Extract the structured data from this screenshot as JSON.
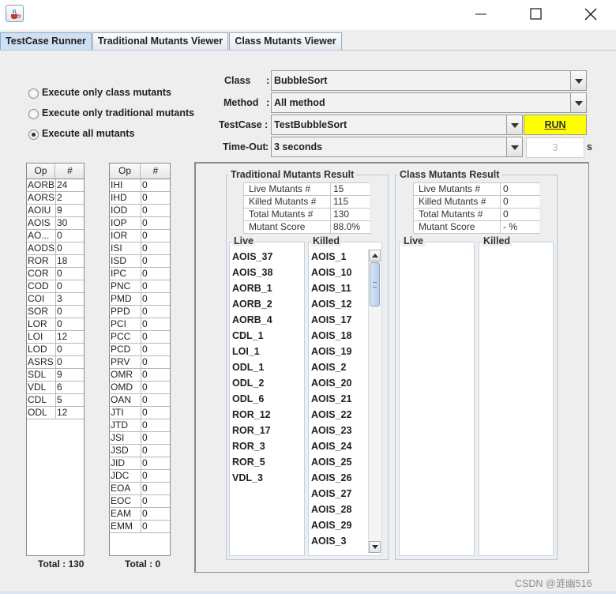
{
  "window": {
    "icons": {
      "app": "java-coffee-cup-icon",
      "minimize": "minimize-icon",
      "maximize": "maximize-icon",
      "close": "close-icon"
    }
  },
  "tabs": [
    "TestCase Runner",
    "Traditional Mutants Viewer",
    "Class Mutants Viewer"
  ],
  "radios": [
    {
      "label": "Execute only class mutants",
      "selected": false
    },
    {
      "label": "Execute only traditional mutants",
      "selected": false
    },
    {
      "label": "Execute all mutants",
      "selected": true
    }
  ],
  "form": {
    "class_label": "Class",
    "class_value": "BubbleSort",
    "method_label": "Method",
    "method_value": "All method",
    "testcase_label": "TestCase",
    "testcase_value": "TestBubbleSort",
    "timeout_label": "Time-Out",
    "timeout_value": "3 seconds",
    "colon": ":",
    "run_label": "RUN",
    "timeout_field_value": "3",
    "timeout_unit": "s"
  },
  "traditional_ops": {
    "headers": [
      "Op",
      "#"
    ],
    "rows": [
      [
        "AORB",
        "24"
      ],
      [
        "AORS",
        "2"
      ],
      [
        "AOIU",
        "9"
      ],
      [
        "AOIS",
        "30"
      ],
      [
        "AO...",
        "0"
      ],
      [
        "AODS",
        "0"
      ],
      [
        "ROR",
        "18"
      ],
      [
        "COR",
        "0"
      ],
      [
        "COD",
        "0"
      ],
      [
        "COI",
        "3"
      ],
      [
        "SOR",
        "0"
      ],
      [
        "LOR",
        "0"
      ],
      [
        "LOI",
        "12"
      ],
      [
        "LOD",
        "0"
      ],
      [
        "ASRS",
        "0"
      ],
      [
        "SDL",
        "9"
      ],
      [
        "VDL",
        "6"
      ],
      [
        "CDL",
        "5"
      ],
      [
        "ODL",
        "12"
      ]
    ],
    "total_label": "Total : 130"
  },
  "class_ops": {
    "headers": [
      "Op",
      "#"
    ],
    "rows": [
      [
        "IHI",
        "0"
      ],
      [
        "IHD",
        "0"
      ],
      [
        "IOD",
        "0"
      ],
      [
        "IOP",
        "0"
      ],
      [
        "IOR",
        "0"
      ],
      [
        "ISI",
        "0"
      ],
      [
        "ISD",
        "0"
      ],
      [
        "IPC",
        "0"
      ],
      [
        "PNC",
        "0"
      ],
      [
        "PMD",
        "0"
      ],
      [
        "PPD",
        "0"
      ],
      [
        "PCI",
        "0"
      ],
      [
        "PCC",
        "0"
      ],
      [
        "PCD",
        "0"
      ],
      [
        "PRV",
        "0"
      ],
      [
        "OMR",
        "0"
      ],
      [
        "OMD",
        "0"
      ],
      [
        "OAN",
        "0"
      ],
      [
        "JTI",
        "0"
      ],
      [
        "JTD",
        "0"
      ],
      [
        "JSI",
        "0"
      ],
      [
        "JSD",
        "0"
      ],
      [
        "JID",
        "0"
      ],
      [
        "JDC",
        "0"
      ],
      [
        "EOA",
        "0"
      ],
      [
        "EOC",
        "0"
      ],
      [
        "EAM",
        "0"
      ],
      [
        "EMM",
        "0"
      ]
    ],
    "total_label": "Total : 0"
  },
  "traditional_result": {
    "title": "Traditional Mutants Result",
    "stats": [
      {
        "label": "Live Mutants #",
        "value": "15"
      },
      {
        "label": "Killed Mutants #",
        "value": "115"
      },
      {
        "label": "Total Mutants #",
        "value": "130"
      },
      {
        "label": "Mutant Score",
        "value": "88.0%"
      }
    ],
    "live_title": "Live",
    "killed_title": "Killed",
    "live": [
      "AOIS_37",
      "AOIS_38",
      "AORB_1",
      "AORB_2",
      "AORB_4",
      "CDL_1",
      "LOI_1",
      "ODL_1",
      "ODL_2",
      "ODL_6",
      "ROR_12",
      "ROR_17",
      "ROR_3",
      "ROR_5",
      "VDL_3"
    ],
    "killed": [
      "AOIS_1",
      "AOIS_10",
      "AOIS_11",
      "AOIS_12",
      "AOIS_17",
      "AOIS_18",
      "AOIS_19",
      "AOIS_2",
      "AOIS_20",
      "AOIS_21",
      "AOIS_22",
      "AOIS_23",
      "AOIS_24",
      "AOIS_25",
      "AOIS_26",
      "AOIS_27",
      "AOIS_28",
      "AOIS_29",
      "AOIS_3"
    ]
  },
  "class_result": {
    "title": "Class Mutants Result",
    "stats": [
      {
        "label": "Live Mutants #",
        "value": "0"
      },
      {
        "label": "Killed Mutants #",
        "value": "0"
      },
      {
        "label": "Total Mutants #",
        "value": "0"
      },
      {
        "label": "Mutant Score",
        "value": " - %"
      }
    ],
    "live_title": "Live",
    "killed_title": "Killed"
  },
  "watermark": "CSDN @涟幽516"
}
